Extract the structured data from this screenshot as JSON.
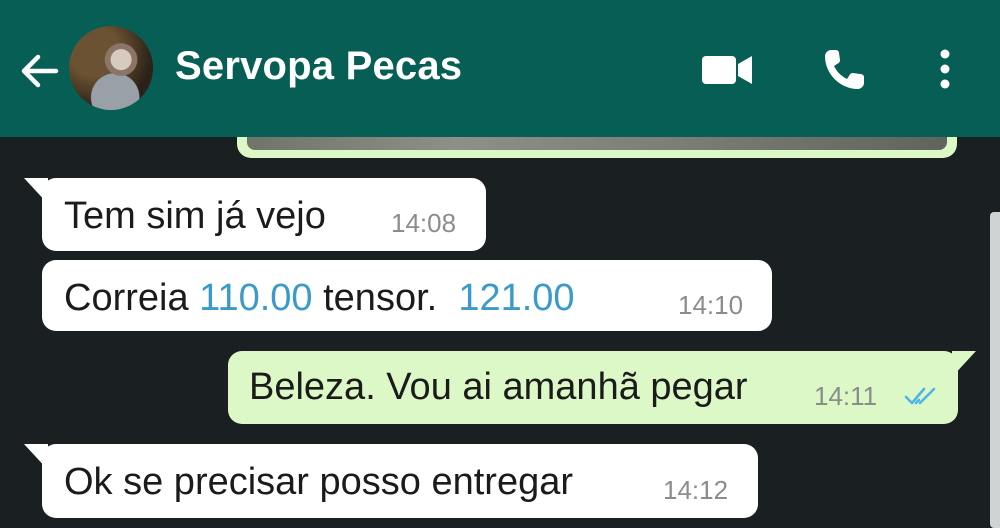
{
  "header": {
    "contact_name": "Servopa Pecas",
    "background": "#075e54",
    "icons": [
      "back-arrow-icon",
      "video-call-icon",
      "phone-icon",
      "more-vert-icon"
    ]
  },
  "messages": [
    {
      "direction": "incoming",
      "text": "Tem sim já vejo",
      "time": "14:08"
    },
    {
      "direction": "incoming",
      "parts": [
        "Correia ",
        "110.00",
        " tensor.  ",
        "121.00"
      ],
      "time": "14:10"
    },
    {
      "direction": "outgoing",
      "text": "Beleza. Vou ai amanhã pegar",
      "time": "14:11",
      "status": "read"
    },
    {
      "direction": "incoming",
      "text": "Ok se precisar posso entregar",
      "time": "14:12"
    }
  ],
  "colors": {
    "incoming_bubble": "#ffffff",
    "outgoing_bubble": "#dcf8c6",
    "chat_background": "#1a1f22",
    "link_number": "#3a9bc9",
    "read_ticks": "#4fb5e6"
  }
}
